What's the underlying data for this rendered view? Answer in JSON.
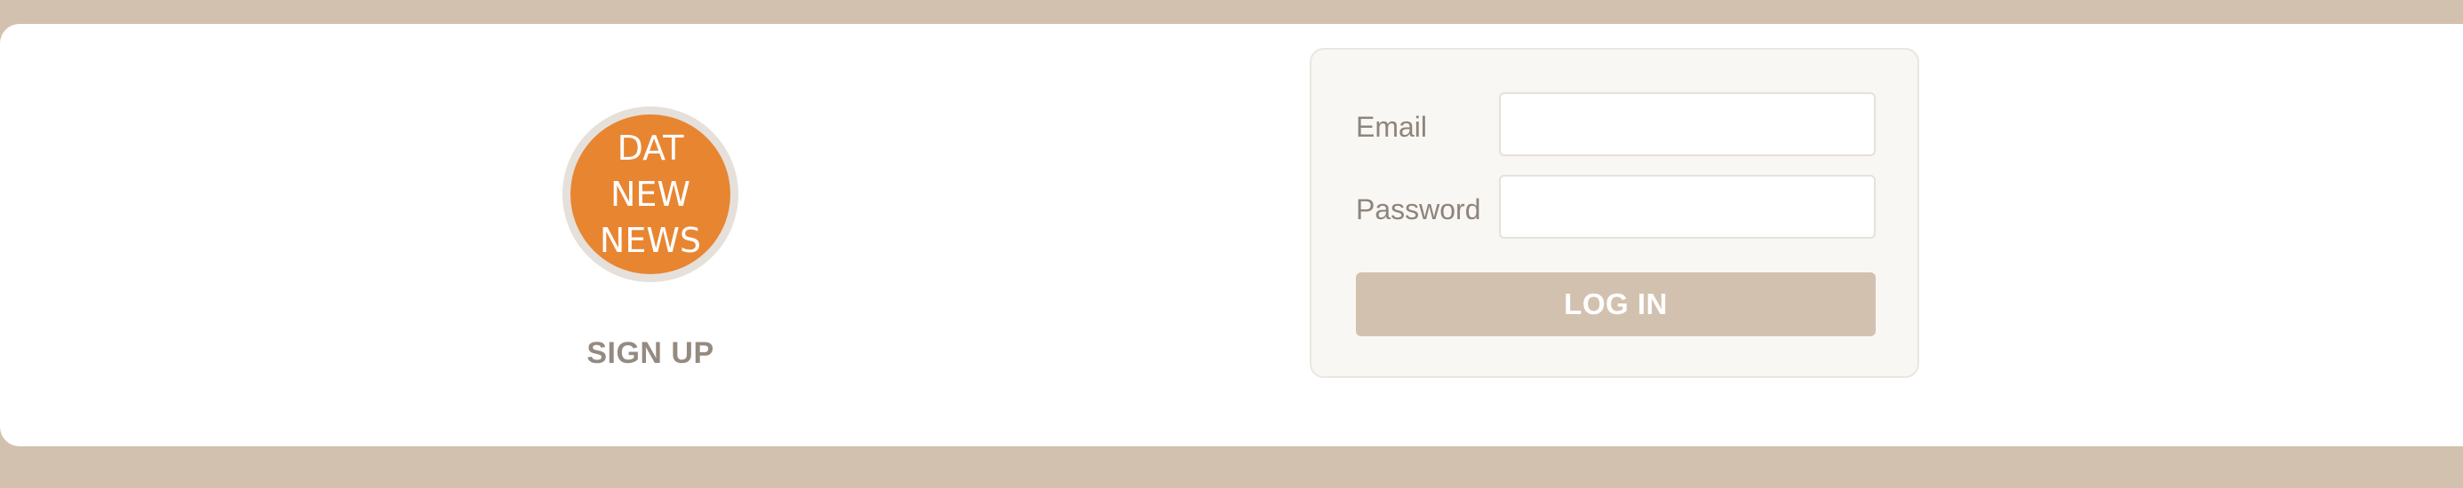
{
  "logo": {
    "lines": [
      "DAT",
      "NEW",
      "NEWS"
    ]
  },
  "signup": {
    "label": "SIGN UP"
  },
  "login": {
    "email_label": "Email",
    "email_value": "",
    "password_label": "Password",
    "password_value": "",
    "submit_label": "LOG IN"
  },
  "colors": {
    "background": "#d3c1b0",
    "logo_fill": "#e88531",
    "button": "#d3c1b0",
    "panel": "#f9f7f4"
  }
}
